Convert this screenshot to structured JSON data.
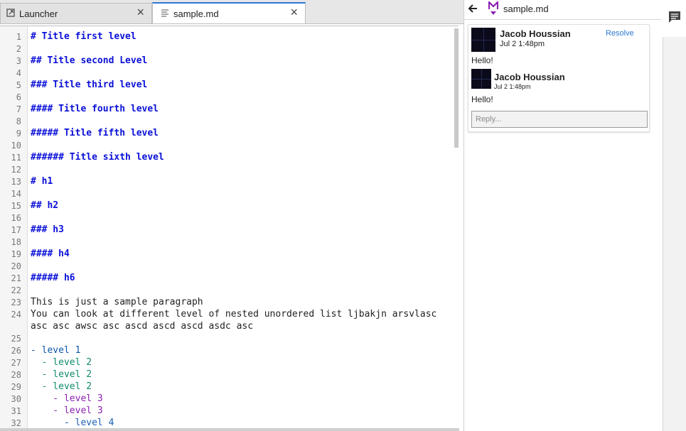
{
  "tabs": [
    {
      "label": "Launcher",
      "icon": "launcher-icon",
      "active": false
    },
    {
      "label": "sample.md",
      "icon": "file-text-icon",
      "active": true
    }
  ],
  "editor": {
    "line_numbers": [
      "1",
      "2",
      "3",
      "4",
      "5",
      "6",
      "7",
      "8",
      "9",
      "10",
      "11",
      "12",
      "13",
      "14",
      "15",
      "16",
      "17",
      "18",
      "19",
      "20",
      "21",
      "22",
      "23",
      "24",
      "",
      "25",
      "26",
      "27",
      "28",
      "29",
      "30",
      "31",
      "32"
    ],
    "lines": [
      "# Title first level",
      "",
      "## Title second Level",
      "",
      "### Title third level",
      "",
      "#### Title fourth level",
      "",
      "##### Title fifth level",
      "",
      "###### Title sixth level",
      "",
      "# h1",
      "",
      "## h2",
      "",
      "### h3",
      "",
      "#### h4",
      "",
      "##### h6",
      "",
      "This is just a sample paragraph",
      "You can look at different level of nested unordered list ljbakjn arsvlasc",
      "asc asc awsc asc ascd ascd ascd asdc asc",
      "",
      "- level 1",
      "  - level 2",
      "  - level 2",
      "  - level 2",
      "    - level 3",
      "    - level 3",
      "      - level 4"
    ]
  },
  "comments_panel": {
    "filename": "sample.md",
    "resolve_label": "Resolve",
    "reply_placeholder": "Reply...",
    "comments": [
      {
        "author": "Jacob Houssian",
        "time": "Jul 2 1:48pm",
        "text": "Hello!"
      },
      {
        "author": "Jacob Houssian",
        "time": "Jul 2 1:48pm",
        "text": "Hello!"
      }
    ]
  },
  "colors": {
    "accent": "#2e78d4",
    "heading": "#0a10d8",
    "md_icon": "#8a20b0"
  }
}
